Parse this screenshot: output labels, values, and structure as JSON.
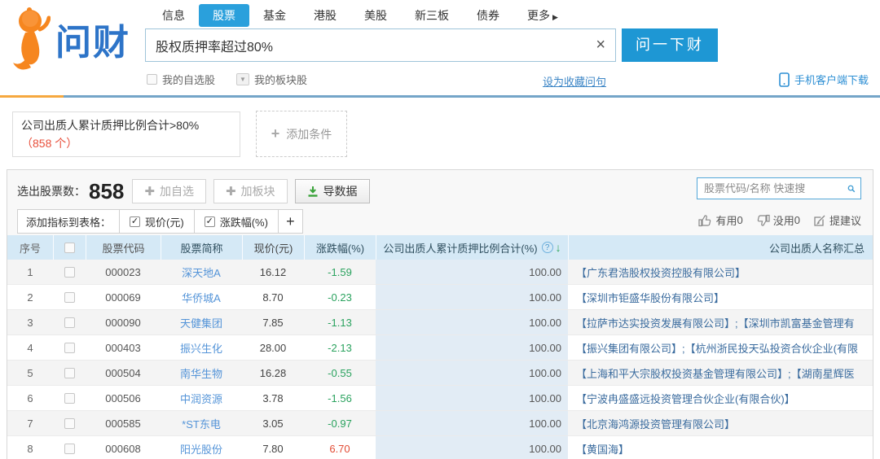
{
  "colors": {
    "accent_blue": "#2aa0dc",
    "button_blue": "#1e97d4",
    "accent_orange": "#f6861f",
    "divider_orange": "#f6a83f",
    "divider_blue": "#74a5c8",
    "table_header_bg": "#d5e9f6",
    "sorted_col_bg": "#e2ecf5",
    "down_green": "#2aa25e",
    "up_red": "#e24c35",
    "count_red": "#e8503c",
    "stock_link": "#5494d8",
    "holder_link": "#3a6b9e"
  },
  "brand": {
    "logo_text": "问财"
  },
  "nav": {
    "tabs": [
      "信息",
      "股票",
      "基金",
      "港股",
      "美股",
      "新三板",
      "债券",
      "更多"
    ],
    "active_index": 1,
    "more_arrow": "▶"
  },
  "search": {
    "query": "股权质押率超过80%",
    "clear_icon": "×",
    "submit_label": "问一下财",
    "my_watchlist_label": "我的自选股",
    "my_sector_label": "我的板块股",
    "sector_arrow": "▼",
    "favorite_link": "设为收藏问句",
    "app_download_label": "手机客户端下载"
  },
  "condition": {
    "text": "公司出质人累计质押比例合计>80% ",
    "count_text": "（858 个）",
    "add_plus": "+",
    "add_label": "添加条件"
  },
  "toolbar": {
    "selected_count_label": "选出股票数：",
    "selected_count": "858",
    "plus_icon": "✚",
    "add_watchlist_label": "加自选",
    "add_sector_label": "加板块",
    "export_label": "导数据",
    "quick_search_placeholder": "股票代码/名称 快速搜",
    "add_indicator_label": "添加指标到表格：",
    "indicator_check": "✓",
    "indicators": [
      "现价(元)",
      "涨跌幅(%)"
    ],
    "add_indicator_plus": "+",
    "useful_label": "有用",
    "useful_count": "0",
    "useless_label": "没用",
    "useless_count": "0",
    "suggest_label": "提建议"
  },
  "table": {
    "columns": [
      "序号",
      "",
      "股票代码",
      "股票简称",
      "现价(元)",
      "涨跌幅(%)",
      "公司出质人累计质押比例合计(%)",
      "公司出质人名称汇总"
    ],
    "help_icon": "?",
    "sort_icon": "↓",
    "rows": [
      {
        "idx": "1",
        "code": "000023",
        "name": "深天地A",
        "price": "16.12",
        "change": "-1.59",
        "direction": "down",
        "ratio": "100.00",
        "holders": "【广东君浩股权投资控股有限公司】"
      },
      {
        "idx": "2",
        "code": "000069",
        "name": "华侨城A",
        "price": "8.70",
        "change": "-0.23",
        "direction": "down",
        "ratio": "100.00",
        "holders": "【深圳市钜盛华股份有限公司】"
      },
      {
        "idx": "3",
        "code": "000090",
        "name": "天健集团",
        "price": "7.85",
        "change": "-1.13",
        "direction": "down",
        "ratio": "100.00",
        "holders": "【拉萨市达实投资发展有限公司】;【深圳市凯富基金管理有"
      },
      {
        "idx": "4",
        "code": "000403",
        "name": "振兴生化",
        "price": "28.00",
        "change": "-2.13",
        "direction": "down",
        "ratio": "100.00",
        "holders": "【振兴集团有限公司】;【杭州浙民投天弘投资合伙企业(有限"
      },
      {
        "idx": "5",
        "code": "000504",
        "name": "南华生物",
        "price": "16.28",
        "change": "-0.55",
        "direction": "down",
        "ratio": "100.00",
        "holders": "【上海和平大宗股权投资基金管理有限公司】;【湖南星辉医"
      },
      {
        "idx": "6",
        "code": "000506",
        "name": "中润资源",
        "price": "3.78",
        "change": "-1.56",
        "direction": "down",
        "ratio": "100.00",
        "holders": "【宁波冉盛盛远投资管理合伙企业(有限合伙)】"
      },
      {
        "idx": "7",
        "code": "000585",
        "name": "*ST东电",
        "price": "3.05",
        "change": "-0.97",
        "direction": "down",
        "ratio": "100.00",
        "holders": "【北京海鸿源投资管理有限公司】"
      },
      {
        "idx": "8",
        "code": "000608",
        "name": "阳光股份",
        "price": "7.80",
        "change": "6.70",
        "direction": "up",
        "ratio": "100.00",
        "holders": "【黄国海】"
      }
    ]
  }
}
